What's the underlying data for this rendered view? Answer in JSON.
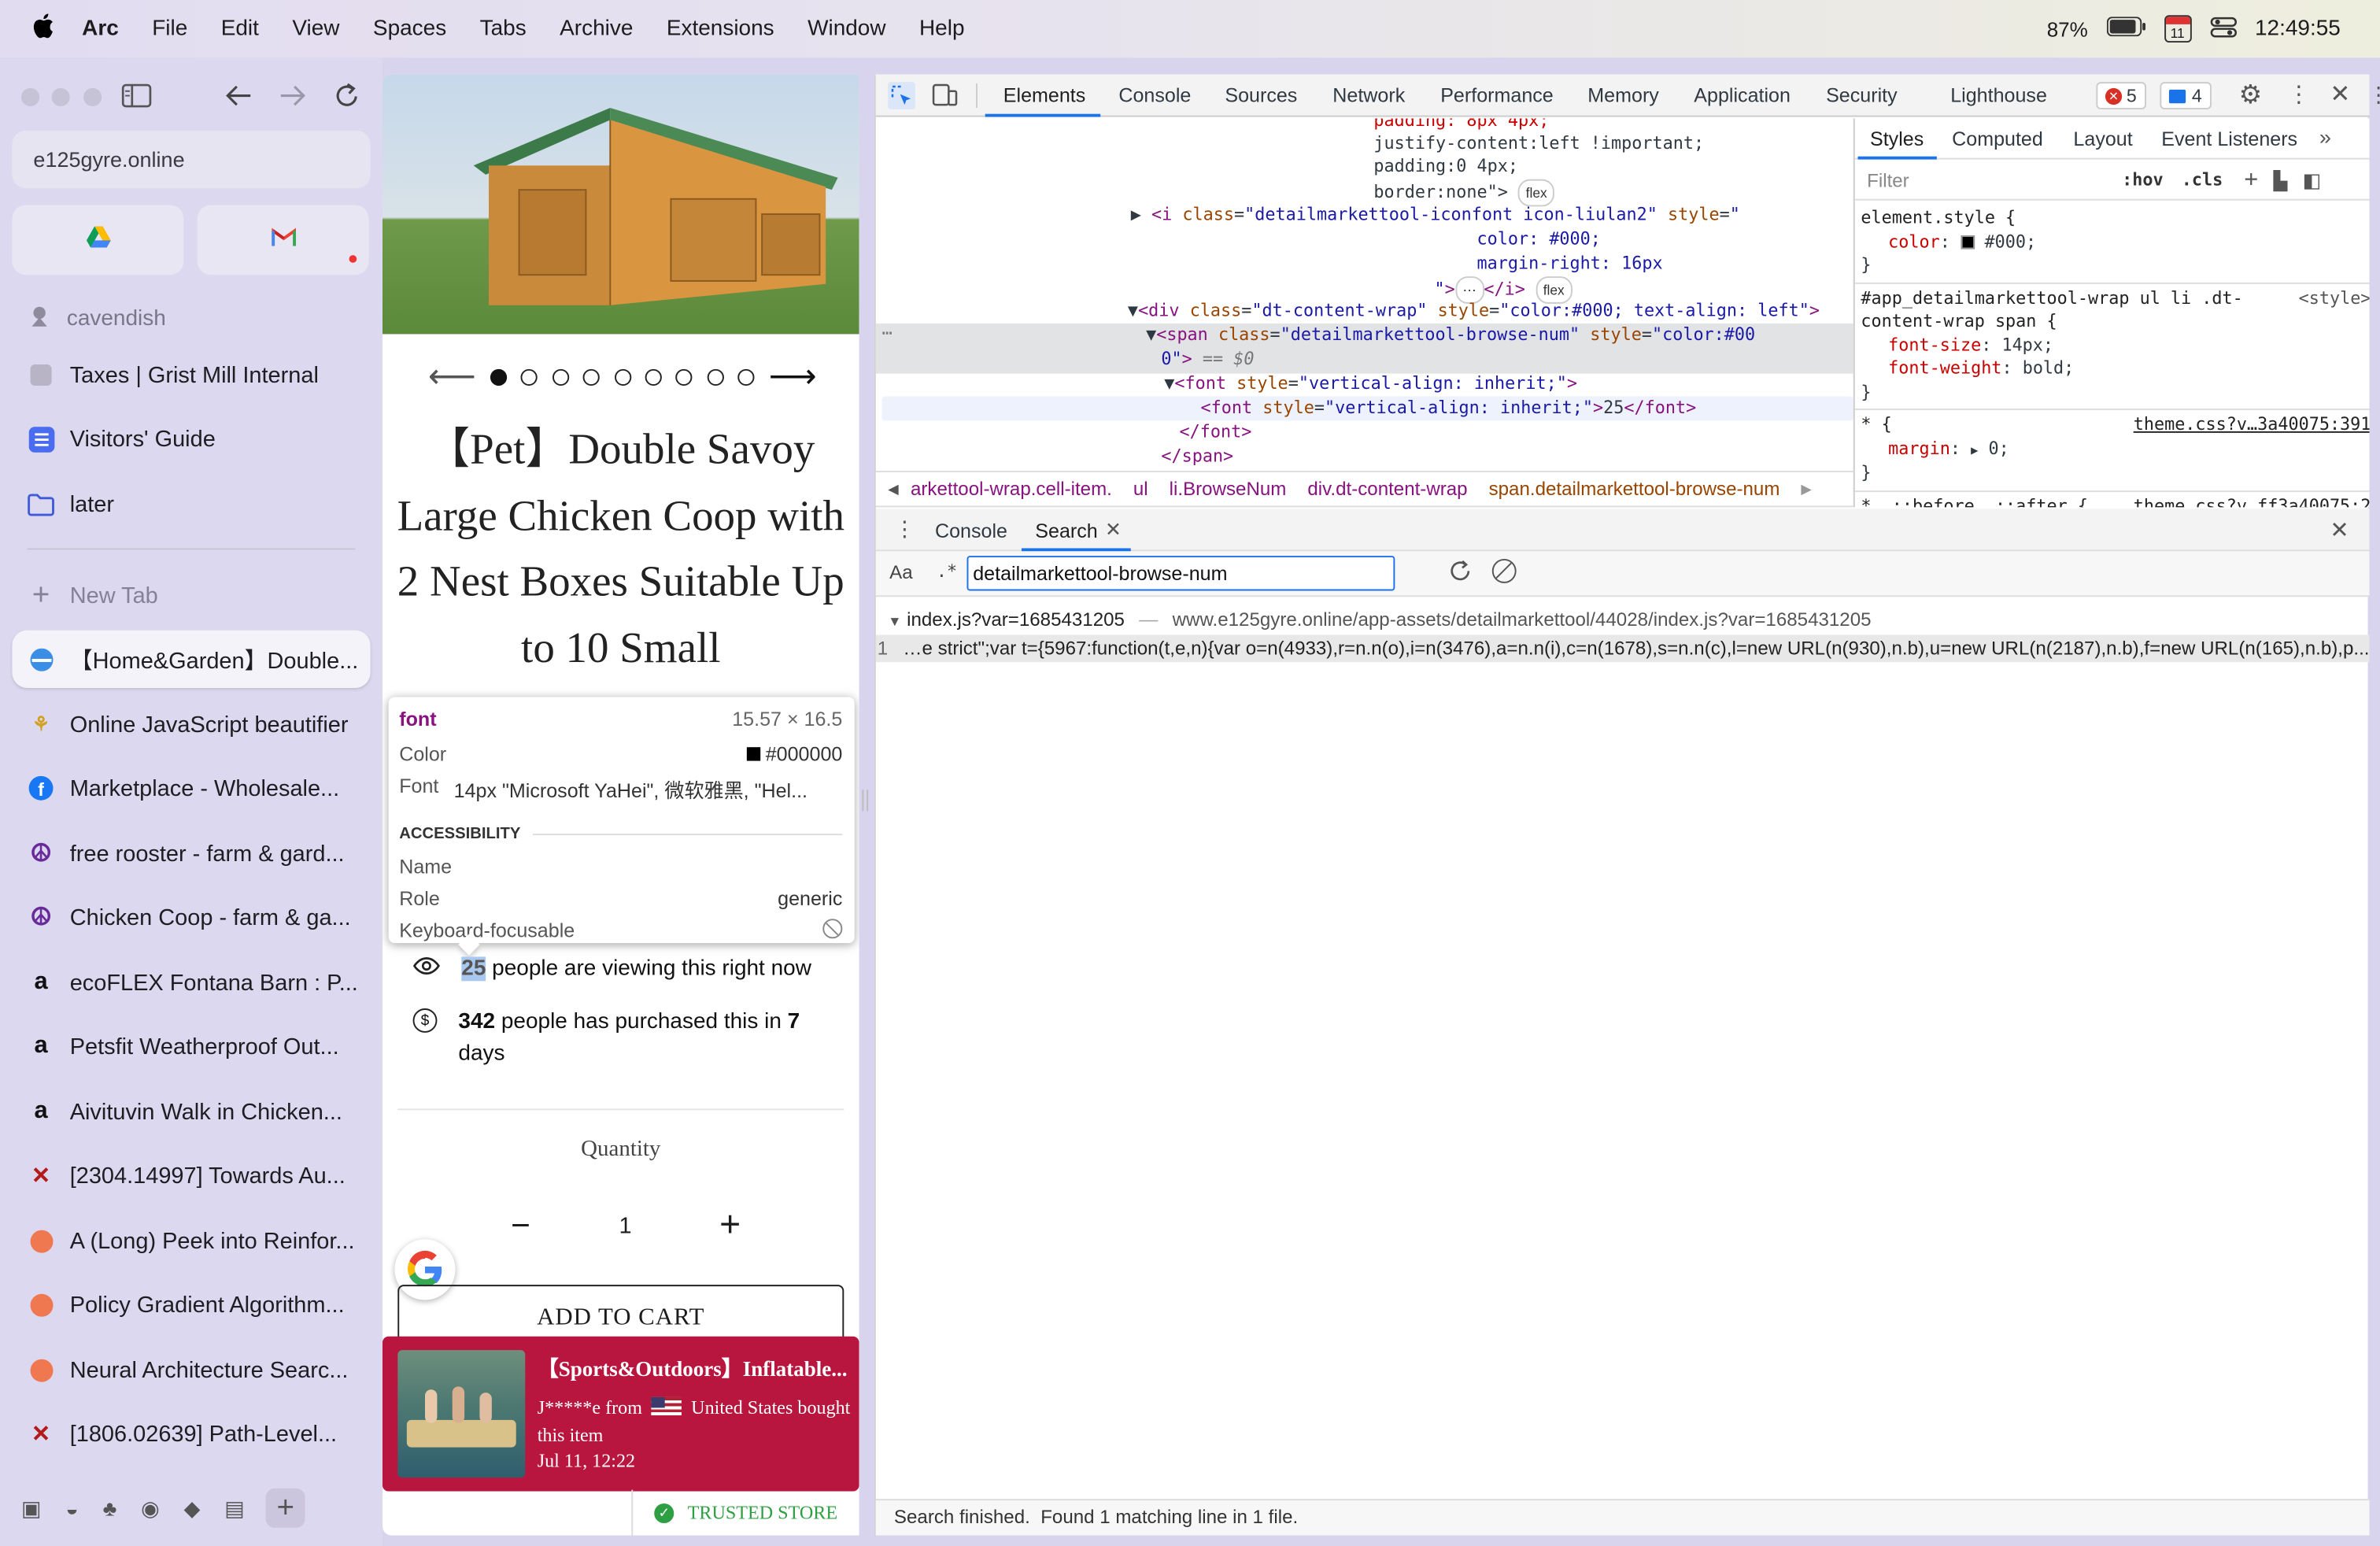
{
  "menubar": {
    "app": "Arc",
    "items": [
      "File",
      "Edit",
      "View",
      "Spaces",
      "Tabs",
      "Archive",
      "Extensions",
      "Window",
      "Help"
    ],
    "battery": "87%",
    "calendar_day": "11",
    "time": "12:49:55"
  },
  "sidebar": {
    "url": "e125gyre.online",
    "space_name": "cavendish",
    "pinned": [
      {
        "label": "Taxes | Grist Mill Internal",
        "icon": "doc-icon"
      },
      {
        "label": "Visitors' Guide",
        "icon": "list-icon"
      },
      {
        "label": "later",
        "icon": "folder-icon"
      }
    ],
    "new_tab": "New Tab",
    "tabs": [
      {
        "label": "【Home&Garden】Double...",
        "icon": "site-icon"
      },
      {
        "label": "Online JavaScript beautifier",
        "icon": "lotus-icon"
      },
      {
        "label": "Marketplace - Wholesale...",
        "icon": "facebook-icon"
      },
      {
        "label": "free rooster - farm & gard...",
        "icon": "peace-icon"
      },
      {
        "label": "Chicken Coop - farm & ga...",
        "icon": "peace-icon"
      },
      {
        "label": "ecoFLEX Fontana Barn : P...",
        "icon": "amazon-icon"
      },
      {
        "label": "Petsfit Weatherproof Out...",
        "icon": "amazon-icon"
      },
      {
        "label": "Aivituvin Walk in Chicken...",
        "icon": "amazon-icon"
      },
      {
        "label": "[2304.14997] Towards Au...",
        "icon": "arxiv-icon"
      },
      {
        "label": "A (Long) Peek into Reinfor...",
        "icon": "peach-icon"
      },
      {
        "label": "Policy Gradient Algorithm...",
        "icon": "peach-icon"
      },
      {
        "label": "Neural Architecture Searc...",
        "icon": "peach-icon"
      },
      {
        "label": "[1806.02639] Path-Level...",
        "icon": "arxiv-icon"
      }
    ]
  },
  "page": {
    "title": "【Pet】Double Savoy Large Chicken Coop with 2 Nest Boxes Suitable Up to 10 Small",
    "tooltip": {
      "tag": "font",
      "size": "15.57 × 16.5",
      "color_label": "Color",
      "color_value": "#000000",
      "font_label": "Font",
      "font_value": "14px \"Microsoft YaHei\", 微软雅黑, \"Hel...",
      "accessibility": "ACCESSIBILITY",
      "name_label": "Name",
      "role_label": "Role",
      "role_value": "generic",
      "focus_label": "Keyboard-focusable"
    },
    "viewing_count": "25",
    "viewing_text": " people are viewing this right now",
    "purchased_count": "342",
    "purchased_text": " people has purchased this in ",
    "purchased_days": "7",
    "purchased_days_unit": "days",
    "quantity_label": "Quantity",
    "quantity_value": "1",
    "add_to_cart": "ADD TO CART",
    "popup_title": "【Sports&Outdoors】Inflatable...",
    "popup_buyer": "J*****e from",
    "popup_country": "United States bought this item",
    "popup_time": "Jul 11, 12:22",
    "trusted": "TRUSTED STORE"
  },
  "devtools": {
    "tabs": [
      "Elements",
      "Console",
      "Sources",
      "Network",
      "Performance",
      "Memory",
      "Application",
      "Security",
      "Lighthouse"
    ],
    "errors": "5",
    "messages": "4",
    "styles_tabs": [
      "Styles",
      "Computed",
      "Layout",
      "Event Listeners"
    ],
    "filter_placeholder": "Filter",
    "hov": ":hov",
    "cls": ".cls",
    "breadcrumbs": [
      "arkettool-wrap.cell-item.",
      "ul",
      "li.BrowseNum",
      "div.dt-content-wrap",
      "span.detailmarkettool-browse-num"
    ],
    "drawer_tabs": [
      "Console",
      "Search"
    ],
    "search_value": "detailmarkettool-browse-num",
    "result_file": "index.js?var=1685431205",
    "result_url": "www.e125gyre.online/app-assets/detailmarkettool/44028/index.js?var=1685431205",
    "result_line_no": "1",
    "result_line": "…e strict\";var t={5967:function(t,e,n){var o=n(4933),r=n.n(o),i=n(3476),a=n.n(i),c=n(1678),s=n.n(c),l=new URL(n(930),n.b),u=new URL(n(2187),n.b),f=new URL(n(165),n.b),p...",
    "status": "Search finished.  Found 1 matching line in 1 file.",
    "css_rules": {
      "element_style": "element.style {",
      "color_prop": "color",
      "color_val": "#000;",
      "rule2_selector": "#app_detailmarkettool-wrap ul li .dt-content-wrap span {",
      "rule2_source": "<style>",
      "fs_prop": "font-size",
      "fs_val": "14px;",
      "fw_prop": "font-weight",
      "fw_val": "bold;",
      "rule3_selector": "* {",
      "rule3_source": "theme.css?v…3a40075:391",
      "margin_prop": "margin",
      "margin_val": "0;",
      "rule4_selector": "*, ::before, ::after {",
      "rule4_source": "theme.css?v…ff3a40075:2"
    }
  }
}
